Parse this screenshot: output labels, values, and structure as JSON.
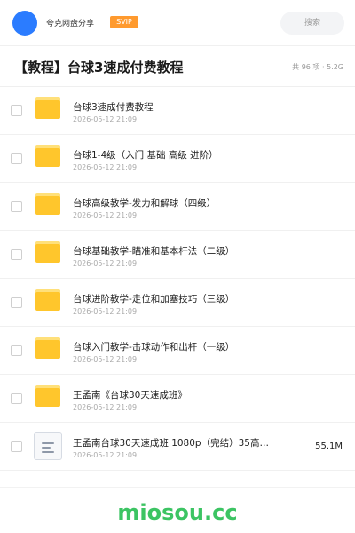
{
  "header": {
    "user_name": "夸克网盘分享",
    "badge": "SVIP",
    "search_label": "搜索",
    "avatar_color": "#2b7cff",
    "badge_color": "#ff9a2e"
  },
  "page": {
    "title": "【教程】台球3速成付费教程",
    "meta": "共 96 项 · 5.2G"
  },
  "files": [
    {
      "type": "folder",
      "icon": "folder-icon",
      "name": "台球3速成付费教程",
      "date": "2026-05-12 21:09",
      "size": ""
    },
    {
      "type": "folder",
      "icon": "folder-icon",
      "name": "台球1-4级（入门 基础 高级 进阶）",
      "date": "2026-05-12 21:09",
      "size": ""
    },
    {
      "type": "folder",
      "icon": "folder-icon",
      "name": "台球高级教学-发力和解球（四级）",
      "date": "2026-05-12 21:09",
      "size": ""
    },
    {
      "type": "folder",
      "icon": "folder-icon",
      "name": "台球基础教学-瞄准和基本杆法（二级）",
      "date": "2026-05-12 21:09",
      "size": ""
    },
    {
      "type": "folder",
      "icon": "folder-icon",
      "name": "台球进阶教学-走位和加塞技巧（三级）",
      "date": "2026-05-12 21:09",
      "size": ""
    },
    {
      "type": "folder",
      "icon": "folder-icon",
      "name": "台球入门教学-击球动作和出杆（一级）",
      "date": "2026-05-12 21:09",
      "size": ""
    },
    {
      "type": "folder",
      "icon": "folder-icon",
      "name": "王孟南《台球30天速成班》",
      "date": "2026-05-12 21:09",
      "size": ""
    },
    {
      "type": "file",
      "icon": "document-icon",
      "name": "王孟南台球30天速成班 1080p（完结）35高…",
      "date": "2026-05-12 21:09",
      "size": "55.1M"
    }
  ],
  "footer": {
    "watermark": "miosou.cc",
    "watermark_color": "#3cc463"
  }
}
